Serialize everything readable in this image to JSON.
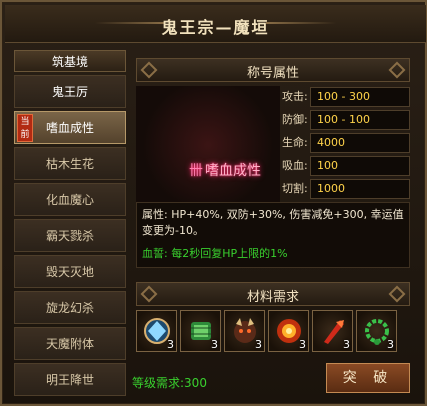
{
  "window": {
    "title": "鬼王宗—魔垣",
    "close_icon": "×"
  },
  "sidebar": {
    "header": "筑基境",
    "current_tag": "当前",
    "items": [
      {
        "label": "鬼王厉",
        "state": "unlocked"
      },
      {
        "label": "嗜血成性",
        "state": "active"
      },
      {
        "label": "枯木生花",
        "state": "locked"
      },
      {
        "label": "化血魔心",
        "state": "locked"
      },
      {
        "label": "霸天戮杀",
        "state": "locked"
      },
      {
        "label": "毁天灭地",
        "state": "locked"
      },
      {
        "label": "旋龙幻杀",
        "state": "locked"
      },
      {
        "label": "天魔附体",
        "state": "locked"
      },
      {
        "label": "明王降世",
        "state": "locked"
      }
    ]
  },
  "title_attr": {
    "header": "称号属性",
    "badge_text": "嗜血成性",
    "badge_mark": "卌",
    "stats": [
      {
        "label": "攻击:",
        "value": "100 - 300"
      },
      {
        "label": "防御:",
        "value": "100 - 100"
      },
      {
        "label": "生命:",
        "value": "4000"
      },
      {
        "label": "吸血:",
        "value": "100"
      },
      {
        "label": "切割:",
        "value": "1000"
      }
    ]
  },
  "description": {
    "attr_text": "属性: HP+40%, 双防+30%, 伤害减免+300, 幸运值变更为-10。",
    "blood_oath": "血誓: 每2秒回复HP上限的1%"
  },
  "materials": {
    "header": "材料需求",
    "items": [
      {
        "icon": "blue-gem-icon",
        "count": "3"
      },
      {
        "icon": "jade-scroll-icon",
        "count": "3"
      },
      {
        "icon": "demon-mask-icon",
        "count": "3"
      },
      {
        "icon": "fire-orb-icon",
        "count": "3"
      },
      {
        "icon": "red-weapon-icon",
        "count": "3"
      },
      {
        "icon": "jade-bead-icon",
        "count": "3"
      }
    ]
  },
  "footer": {
    "requirement": "等级需求:300",
    "break_label": "突 破"
  }
}
